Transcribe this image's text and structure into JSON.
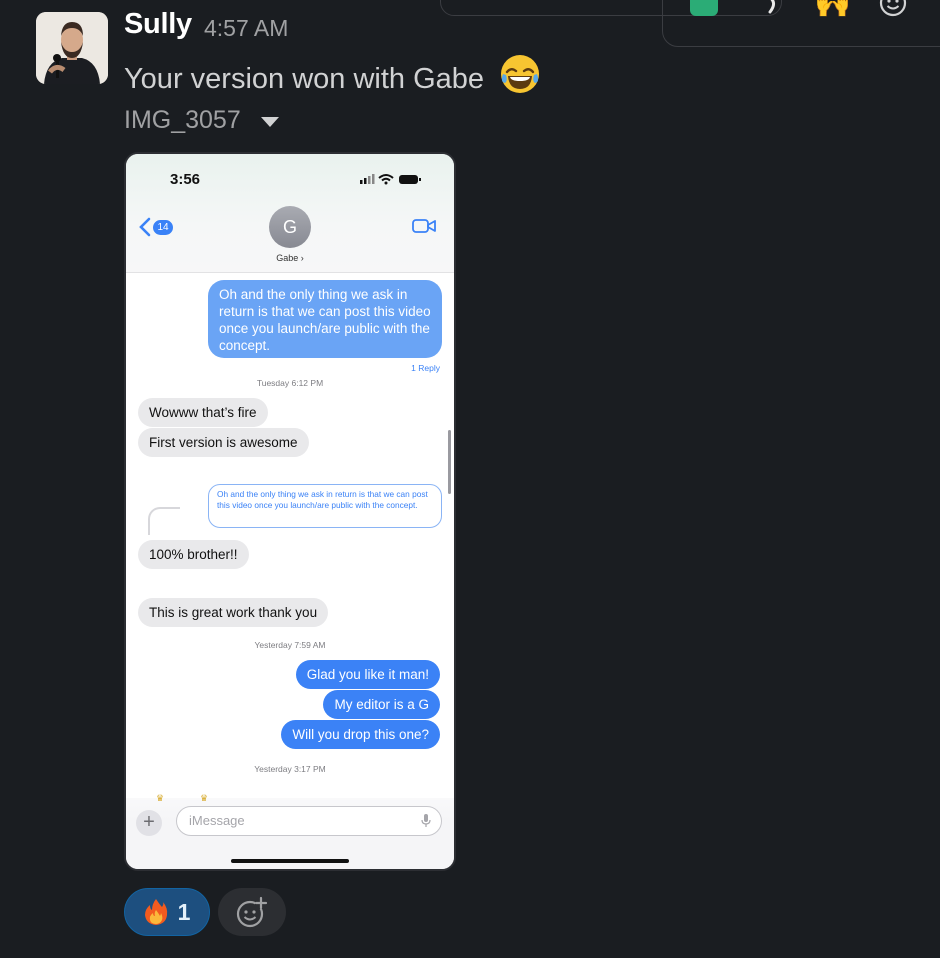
{
  "message": {
    "sender": "Sully",
    "time": "4:57 AM",
    "text": "Your version won with Gabe",
    "emoji_icon": "joy-emoji",
    "file_name": "IMG_3057"
  },
  "phone_screenshot": {
    "status_time": "3:56",
    "back_badge": "14",
    "contact_initial": "G",
    "contact_name": "Gabe ›",
    "messages": [
      {
        "type": "outgoing",
        "text": "Oh and the only thing we ask in return is that we can post this video once you launch/are public with the concept."
      },
      {
        "type": "reply_count",
        "text": "1 Reply"
      },
      {
        "type": "timestamp",
        "text": "Tuesday 6:12 PM"
      },
      {
        "type": "incoming",
        "text": "Wowww that’s fire"
      },
      {
        "type": "incoming",
        "text": "First version is awesome"
      },
      {
        "type": "quoted",
        "text": "Oh and the only thing we ask in return is that we can post this video once you launch/are public with the concept."
      },
      {
        "type": "incoming",
        "text": "100% brother!!"
      },
      {
        "type": "incoming",
        "text": "This is great work thank you"
      },
      {
        "type": "timestamp",
        "text": "Yesterday 7:59 AM"
      },
      {
        "type": "outgoing",
        "text": "Glad you like it man!"
      },
      {
        "type": "outgoing",
        "text": "My editor is a G"
      },
      {
        "type": "outgoing",
        "text": "Will you drop this one?"
      },
      {
        "type": "timestamp",
        "text": "Yesterday 3:17 PM"
      }
    ],
    "input_placeholder": "iMessage"
  },
  "reactions": [
    {
      "emoji": "fire-emoji",
      "count": "1",
      "selected": true
    }
  ],
  "toolbar_emojis": [
    "raised-hands-emoji",
    "add-reaction-icon"
  ],
  "colors": {
    "background": "#1a1d21",
    "reaction_selected_bg": "#1d4f7f",
    "reaction_selected_border": "#1264a3",
    "imessage_blue": "#3b82f6"
  }
}
